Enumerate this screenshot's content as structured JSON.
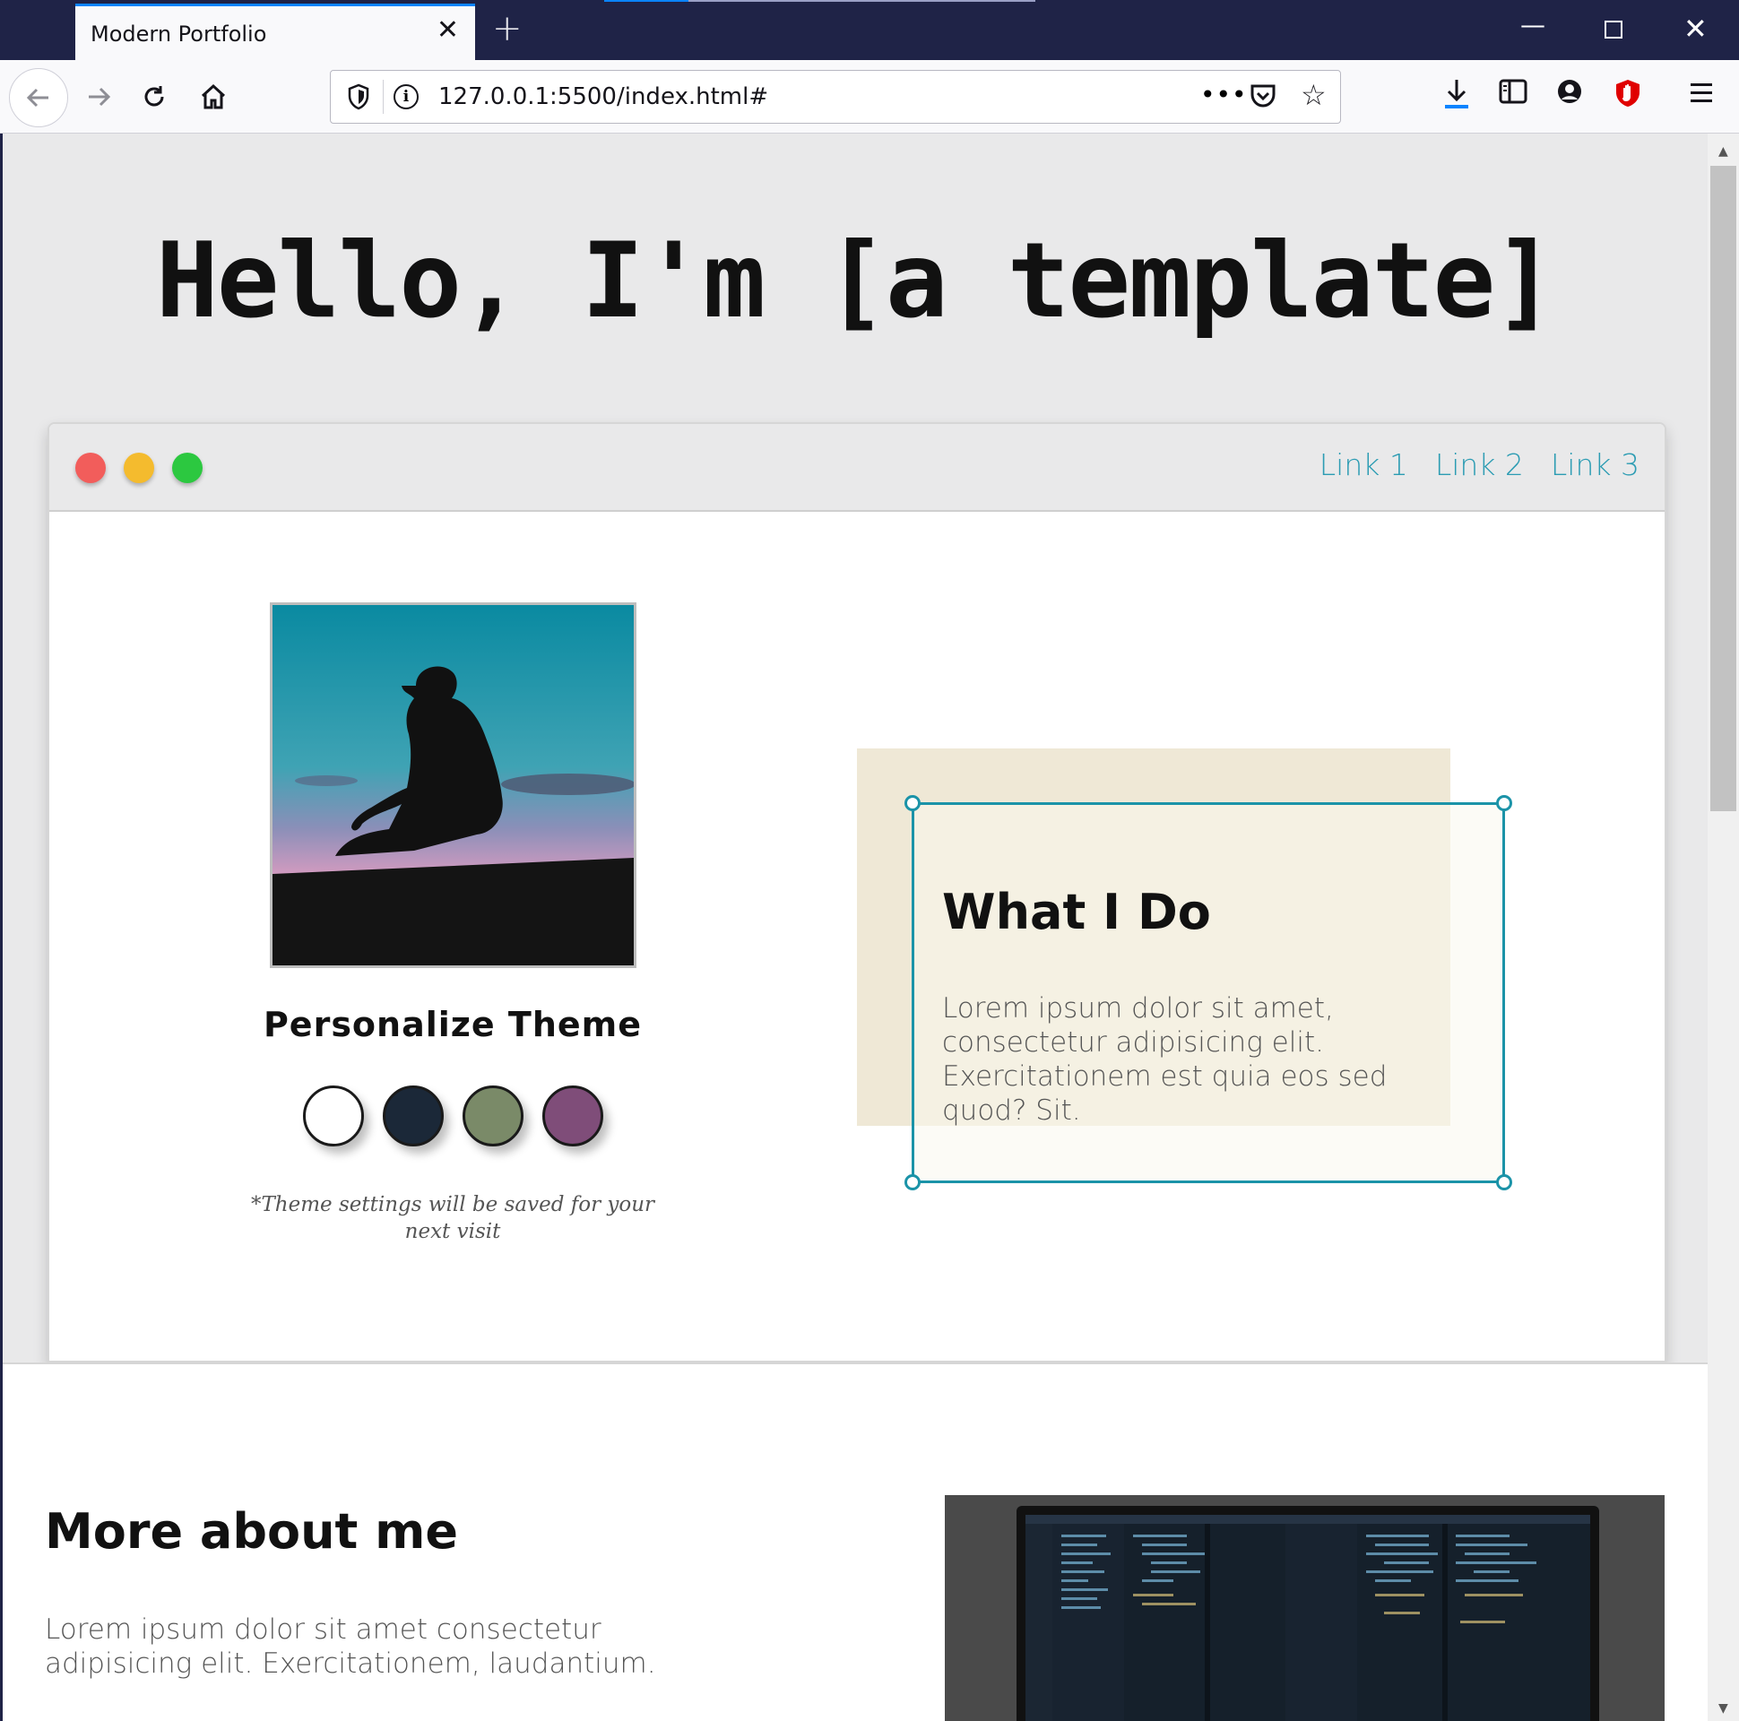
{
  "browser": {
    "tab_title": "Modern Portfolio",
    "url": "127.0.0.1:5500/index.html#",
    "url_more": "•••"
  },
  "page": {
    "hero_title": "Hello, I'm [a template]",
    "mock_window": {
      "links": [
        "Link 1",
        "Link 2",
        "Link 3"
      ]
    },
    "theme": {
      "title": "Personalize Theme",
      "swatch_colors": [
        "#ffffff",
        "#1b2838",
        "#7a8a68",
        "#7f4d79"
      ],
      "note": "*Theme settings will be saved for your next visit"
    },
    "what_i_do": {
      "title": "What I Do",
      "text": "Lorem ipsum dolor sit amet, consectetur adipisicing elit. Exercitationem est quia eos sed quod? Sit."
    },
    "about": {
      "title": "More about me",
      "text": "Lorem ipsum dolor sit amet consectetur adipisicing elit. Exercitationem, laudantium."
    }
  },
  "colors": {
    "accent": "#2c9cb3",
    "card_border": "#1b93a8",
    "card_bg": "#efe8d6",
    "chrome_dark": "#1f2347"
  }
}
